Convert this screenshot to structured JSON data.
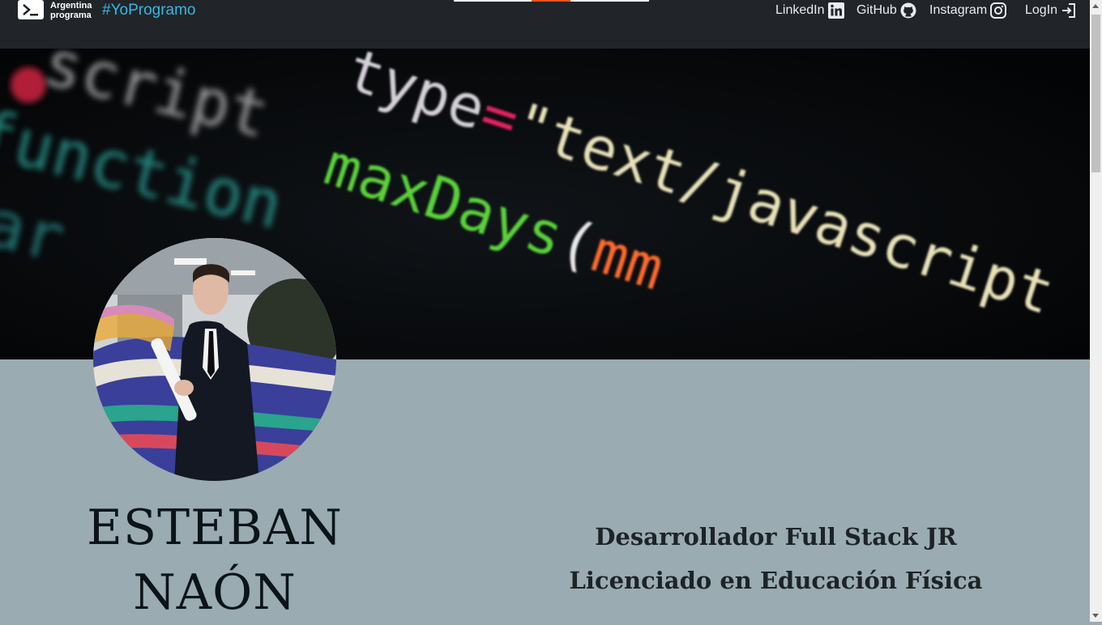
{
  "nav": {
    "brand_line1": "Argentina",
    "brand_line2": "programa",
    "hashtag": "#YoProgramo",
    "links": [
      {
        "label": "LinkedIn",
        "icon": "linkedin-icon"
      },
      {
        "label": "GitHub",
        "icon": "github-icon"
      },
      {
        "label": "Instagram",
        "icon": "instagram-icon"
      },
      {
        "label": "LogIn",
        "icon": "login-icon"
      }
    ]
  },
  "banner": {
    "code_line1": "<script type=\"text/javascript",
    "code_line2": "function maxDays(",
    "code_word_var": "var"
  },
  "profile": {
    "first_name": "ESTEBAN",
    "last_name": "NAÓN",
    "role1": "Desarrollador Full Stack JR",
    "role2": "Licenciado en Educación Física"
  },
  "colors": {
    "navbar": "#212529",
    "hashtag": "#33b9e6",
    "body_bg": "#9aabb2",
    "accent": "#e8541e"
  }
}
